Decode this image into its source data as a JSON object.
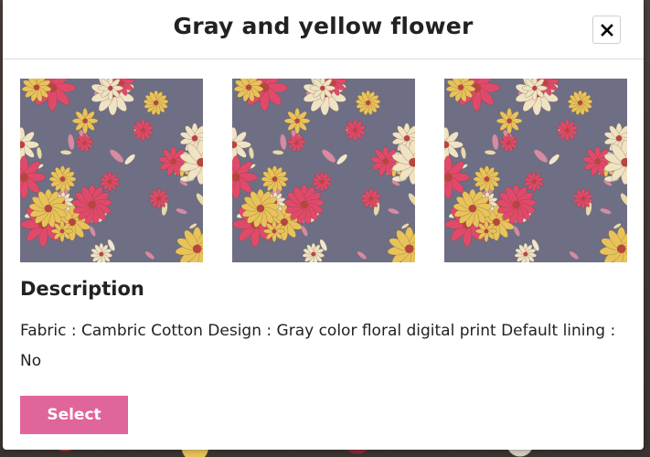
{
  "modal": {
    "title": "Gray and yellow flower",
    "close_icon": "close-icon",
    "gallery": [
      {
        "label": "fabric-swatch-1"
      },
      {
        "label": "fabric-swatch-2"
      },
      {
        "label": "fabric-swatch-3"
      }
    ],
    "description_heading": "Description",
    "description_text": "Fabric : Cambric Cotton Design : Gray color floral digital print Default lining : No",
    "select_label": "Select"
  },
  "colors": {
    "accent": "#e0659a",
    "fabric_base": "#6e6f85",
    "flower_yellow": "#e8c35a",
    "flower_pink": "#e04a6a",
    "flower_cream": "#efe3c4"
  }
}
